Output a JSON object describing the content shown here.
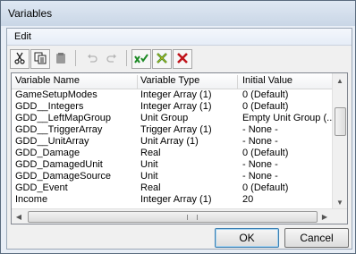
{
  "window": {
    "title": "Variables"
  },
  "menu": {
    "edit": "Edit"
  },
  "toolbar": {
    "icons": [
      "scissors-icon",
      "copy-icon",
      "paste-icon",
      "undo-icon",
      "redo-icon",
      "new-variable-icon",
      "edit-variable-icon",
      "delete-variable-icon"
    ]
  },
  "table": {
    "columns": [
      "Variable Name",
      "Variable Type",
      "Initial Value"
    ],
    "rows": [
      [
        "GameSetupModes",
        "Integer Array (1)",
        "0 (Default)"
      ],
      [
        "GDD__Integers",
        "Integer Array (1)",
        "0 (Default)"
      ],
      [
        "GDD__LeftMapGroup",
        "Unit Group",
        "Empty Unit Group (..."
      ],
      [
        "GDD__TriggerArray",
        "Trigger Array (1)",
        "- None -"
      ],
      [
        "GDD__UnitArray",
        "Unit Array (1)",
        "- None -"
      ],
      [
        "GDD_Damage",
        "Real",
        "0 (Default)"
      ],
      [
        "GDD_DamagedUnit",
        "Unit",
        "- None -"
      ],
      [
        "GDD_DamageSource",
        "Unit",
        "- None -"
      ],
      [
        "GDD_Event",
        "Real",
        "0 (Default)"
      ],
      [
        "Income",
        "Integer Array (1)",
        "20"
      ]
    ]
  },
  "buttons": {
    "ok": "OK",
    "cancel": "Cancel"
  },
  "colors": {
    "delete_red": "#c0141b",
    "new_green": "#1e8a26",
    "check_yellow": "#c8b21a"
  }
}
